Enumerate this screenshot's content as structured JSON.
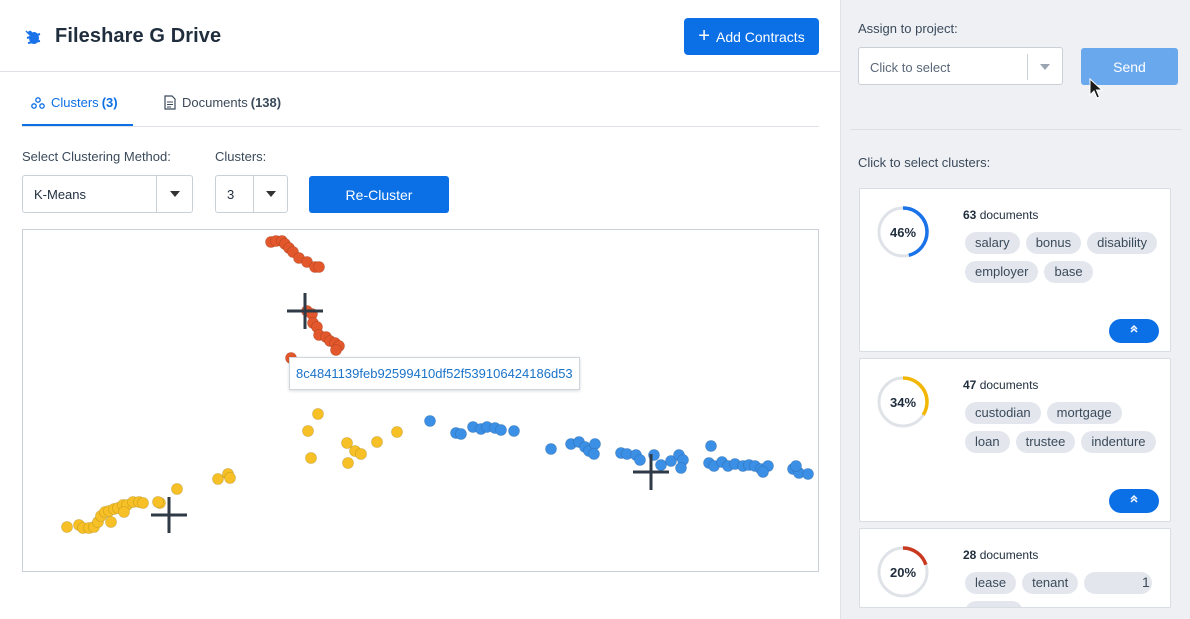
{
  "header": {
    "title": "Fileshare G Drive",
    "add_button": "Add Contracts",
    "logo_icon": "bug-icon"
  },
  "tabs": [
    {
      "label": "Clusters",
      "count": "(3)",
      "icon": "clusters-icon"
    },
    {
      "label": "Documents",
      "count": "(138)",
      "icon": "document-icon"
    }
  ],
  "controls": {
    "method_label": "Select Clustering Method:",
    "method_value": "K-Means",
    "clusters_label": "Clusters:",
    "clusters_value": "3",
    "recluster_label": "Re-Cluster"
  },
  "plot": {
    "tooltip": "8c4841139feb92599410df52f539106424186d53",
    "colors": {
      "red": "#e2572b",
      "yellow": "#f6c026",
      "blue": "#3b8fe5",
      "centroid": "#2e3a46"
    }
  },
  "sidebar": {
    "assign_label": "Assign to project:",
    "project_placeholder": "Click to select",
    "send_label": "Send",
    "select_clusters_label": "Click to select clusters:",
    "clusters": [
      {
        "percent": "46%",
        "pct_value": 46,
        "docs": "63",
        "docs_label": "documents",
        "color": "#1a73e8",
        "keywords": [
          "salary",
          "bonus",
          "disability",
          "employer",
          "base"
        ]
      },
      {
        "percent": "34%",
        "pct_value": 34,
        "docs": "47",
        "docs_label": "documents",
        "color": "#f2b705",
        "keywords": [
          "custodian",
          "mortgage",
          "loan",
          "trustee",
          "indenture"
        ]
      },
      {
        "percent": "20%",
        "pct_value": 20,
        "docs": "28",
        "docs_label": "documents",
        "color": "#c8391f",
        "keywords": [
          "lease",
          "tenant"
        ],
        "extra": "1"
      }
    ]
  }
}
